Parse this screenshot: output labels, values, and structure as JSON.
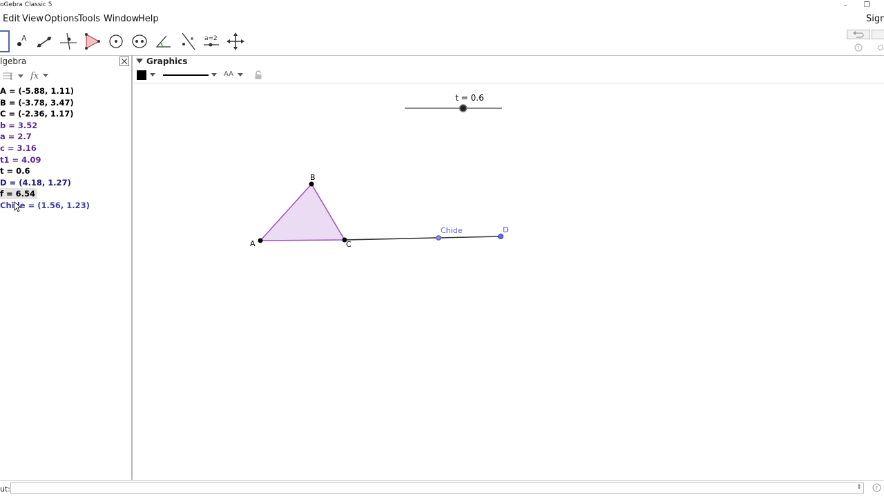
{
  "window": {
    "title": "oGebra Classic 5",
    "sign_in": "Sign"
  },
  "menu": [
    {
      "label": "Edit"
    },
    {
      "label": "View"
    },
    {
      "label": "Options"
    },
    {
      "label": "Tools"
    },
    {
      "label": "Window"
    },
    {
      "label": "Help"
    }
  ],
  "toolbar": {
    "tools": [
      "move",
      "point",
      "line",
      "perpendicular-line",
      "polygon",
      "circle",
      "conic",
      "angle",
      "reflect",
      "slider",
      "move-graphics-view"
    ],
    "slider_tool_text": "a=2"
  },
  "algebra": {
    "title": "lgebra",
    "items": [
      {
        "text": "A = (-5.88, 1.11)",
        "color": "#000000"
      },
      {
        "text": "B = (-3.78, 3.47)",
        "color": "#000000"
      },
      {
        "text": "C = (-2.36, 1.17)",
        "color": "#000000"
      },
      {
        "text": "b = 3.52",
        "color": "#6a2a9a"
      },
      {
        "text": "a = 2.7",
        "color": "#6a2a9a"
      },
      {
        "text": "c = 3.16",
        "color": "#6a2a9a"
      },
      {
        "text": "t1 = 4.09",
        "color": "#6a2a9a"
      },
      {
        "text": "t = 0.6",
        "color": "#000000"
      },
      {
        "text": "D = (4.18, 1.27)",
        "color": "#1a1a7a"
      },
      {
        "text": "f = 6.54",
        "color": "#000000",
        "selected": true
      },
      {
        "text": "Chide = (1.56, 1.23)",
        "color": "#3a3aa0"
      }
    ]
  },
  "graphics": {
    "title": "Graphics",
    "style_bar": {
      "font_label": "AA"
    },
    "slider": {
      "label": "t = 0.6",
      "value": 0.6,
      "min": 0,
      "max": 1
    },
    "points": {
      "A": {
        "label": "A"
      },
      "B": {
        "label": "B"
      },
      "C": {
        "label": "C"
      },
      "D": {
        "label": "D"
      },
      "Chide": {
        "label": "Chide"
      }
    },
    "colors": {
      "polygon_fill": "#e8d6f2",
      "polygon_stroke": "#9a4bc2",
      "segment": "#333333",
      "point_blue": "#5a5ad0",
      "slider_point": "#222222"
    }
  },
  "input": {
    "label": "ut:"
  }
}
